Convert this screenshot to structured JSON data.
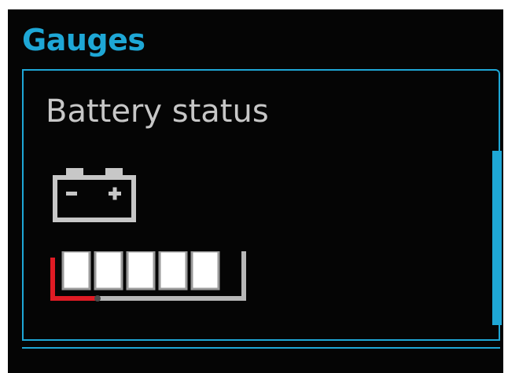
{
  "screen": {
    "heading": "Gauges"
  },
  "panel": {
    "title": "Battery status",
    "icon": "car-battery-icon"
  },
  "battery_gauge": {
    "segments_total": 5,
    "segments_filled": 5,
    "warning_marker": "low-level"
  },
  "colors": {
    "accent": "#1ea7d6",
    "text": "#c7c7c7",
    "background": "#050505",
    "warning": "#e01b24",
    "segment_fill": "#ffffff"
  }
}
